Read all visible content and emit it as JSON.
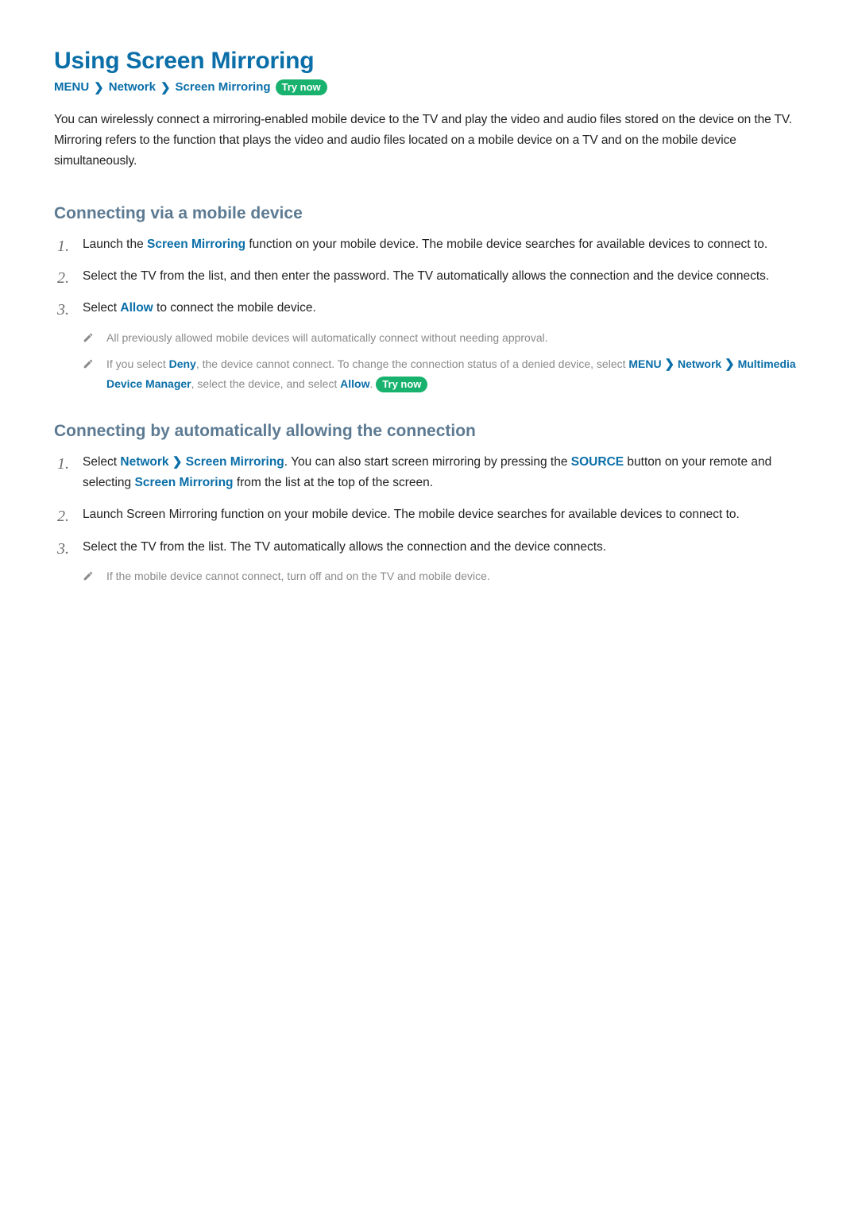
{
  "title": "Using Screen Mirroring",
  "breadcrumb": {
    "menu": "MENU",
    "network": "Network",
    "screen_mirroring": "Screen Mirroring",
    "try_now": "Try now"
  },
  "intro": "You can wirelessly connect a mirroring-enabled mobile device to the TV and play the video and audio files stored on the device on the TV. Mirroring refers to the function that plays the video and audio files located on a mobile device on a TV and on the mobile device simultaneously.",
  "section1": {
    "heading": "Connecting via a mobile device",
    "step1_a": "Launch the ",
    "step1_accent": "Screen Mirroring",
    "step1_b": " function on your mobile device. The mobile device searches for available devices to connect to.",
    "step2": "Select the TV from the list, and then enter the password. The TV automatically allows the connection and the device connects.",
    "step3_a": "Select ",
    "step3_accent": "Allow",
    "step3_b": " to connect the mobile device.",
    "note1": "All previously allowed mobile devices will automatically connect without needing approval.",
    "note2_a": "If you select ",
    "note2_deny": "Deny",
    "note2_b": ", the device cannot connect. To change the connection status of a denied device, select ",
    "note2_menu": "MENU",
    "note2_network": "Network",
    "note2_mdm": "Multimedia Device Manager",
    "note2_c": ", select the device, and select ",
    "note2_allow": "Allow",
    "note2_d": ". ",
    "note2_try": "Try now"
  },
  "section2": {
    "heading": "Connecting by automatically allowing the connection",
    "step1_a": "Select ",
    "step1_network": "Network",
    "step1_sm": "Screen Mirroring",
    "step1_b": ". You can also start screen mirroring by pressing the ",
    "step1_source": "SOURCE",
    "step1_c": " button on your remote and selecting ",
    "step1_sm2": "Screen Mirroring",
    "step1_d": " from the list at the top of the screen.",
    "step2": "Launch Screen Mirroring function on your mobile device. The mobile device searches for available devices to connect to.",
    "step3": "Select the TV from the list. The TV automatically allows the connection and the device connects.",
    "note1": "If the mobile device cannot connect, turn off and on the TV and mobile device."
  }
}
